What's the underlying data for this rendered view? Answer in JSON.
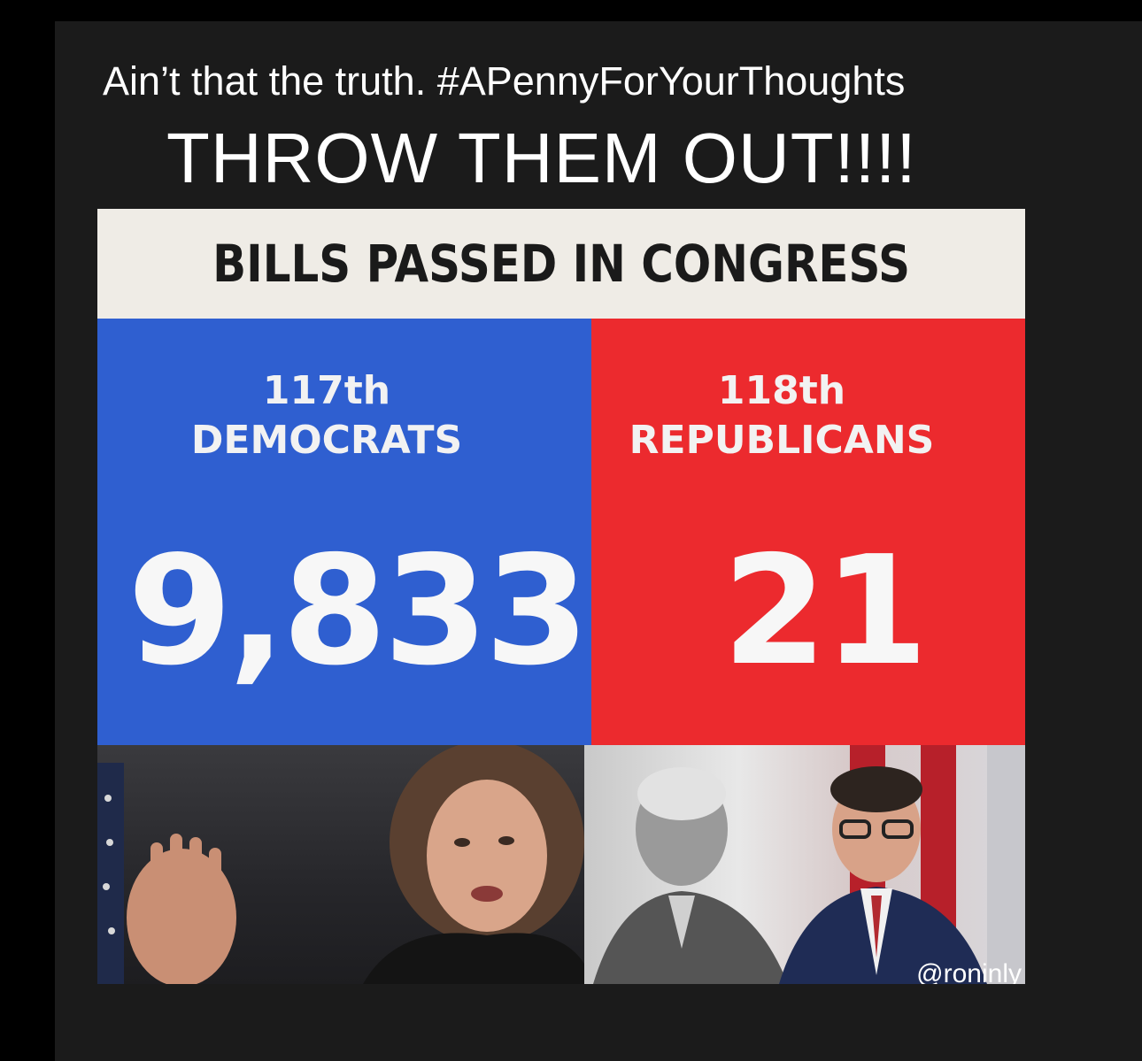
{
  "post": {
    "caption": "Ain’t that the truth. #APennyForYourThoughts",
    "headline": "THROW THEM OUT!!!!"
  },
  "meme": {
    "title": "BILLS PASSED IN CONGRESS",
    "left": {
      "session": "117th",
      "party": "DEMOCRATS",
      "count": "9,833",
      "color": "#2f5fd0"
    },
    "right": {
      "session": "118th",
      "party": "REPUBLICANS",
      "count": "21",
      "color": "#ec2a2e"
    },
    "watermark": "@roninly"
  }
}
